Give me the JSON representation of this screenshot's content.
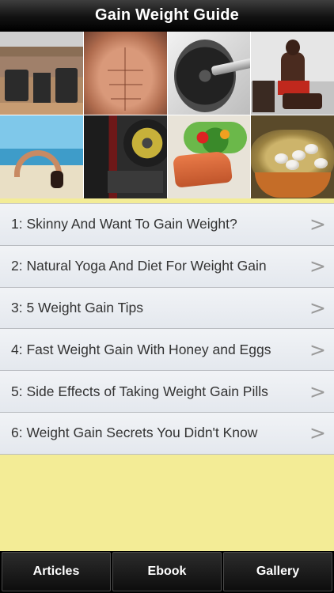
{
  "nav": {
    "title": "Gain Weight Guide"
  },
  "gallery": {
    "photos": [
      {
        "subject": "gym interior"
      },
      {
        "subject": "muscular abs"
      },
      {
        "subject": "dumbbell"
      },
      {
        "subject": "man resting on bench"
      },
      {
        "subject": "yoga backbend on beach"
      },
      {
        "subject": "weight plate"
      },
      {
        "subject": "salmon with salad"
      },
      {
        "subject": "eggs in nest"
      }
    ]
  },
  "articles": [
    {
      "label": "1: Skinny And Want To Gain Weight?"
    },
    {
      "label": "2: Natural Yoga And Diet For Weight Gain"
    },
    {
      "label": "3: 5 Weight Gain Tips"
    },
    {
      "label": "4: Fast Weight Gain With Honey and Eggs"
    },
    {
      "label": "5: Side Effects of Taking Weight Gain Pills"
    },
    {
      "label": "6: Weight Gain Secrets You Didn't Know"
    }
  ],
  "chevron": ">",
  "tabs": [
    {
      "label": "Articles"
    },
    {
      "label": "Ebook"
    },
    {
      "label": "Gallery"
    }
  ],
  "colors": {
    "background": "#f3ec96",
    "nav_bar": "#000000",
    "row_text": "#333333",
    "chevron": "#9b9b9b"
  }
}
